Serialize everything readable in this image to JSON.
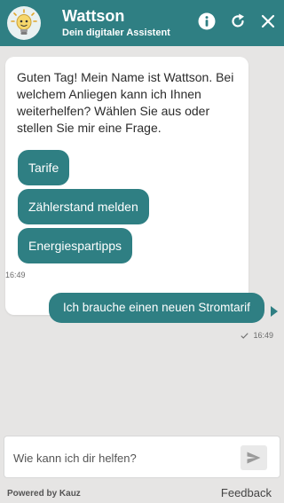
{
  "header": {
    "title": "Wattson",
    "subtitle": "Dein digitaler Assistent",
    "avatar_icon": "lightbulb-icon",
    "info_icon": "info-icon",
    "reload_icon": "reload-icon",
    "close_icon": "close-icon"
  },
  "chat": {
    "bot_message": "Guten Tag! Mein Name ist Wattson. Bei welchem Anliegen kann ich Ihnen weiterhelfen? Wählen Sie aus oder stellen Sie mir eine Frage.",
    "quick_replies": [
      "Tarife",
      "Zählerstand melden",
      "Energiespartipps"
    ],
    "bot_time": "16:49",
    "user_message": "Ich brauche einen neuen Stromtarif",
    "user_time": "16:49"
  },
  "composer": {
    "placeholder": "Wie kann ich dir helfen?",
    "send_icon": "send-icon"
  },
  "footer": {
    "powered_by": "Powered by Kauz",
    "feedback": "Feedback"
  },
  "colors": {
    "accent": "#2f7f83",
    "background": "#e6e5e4"
  }
}
